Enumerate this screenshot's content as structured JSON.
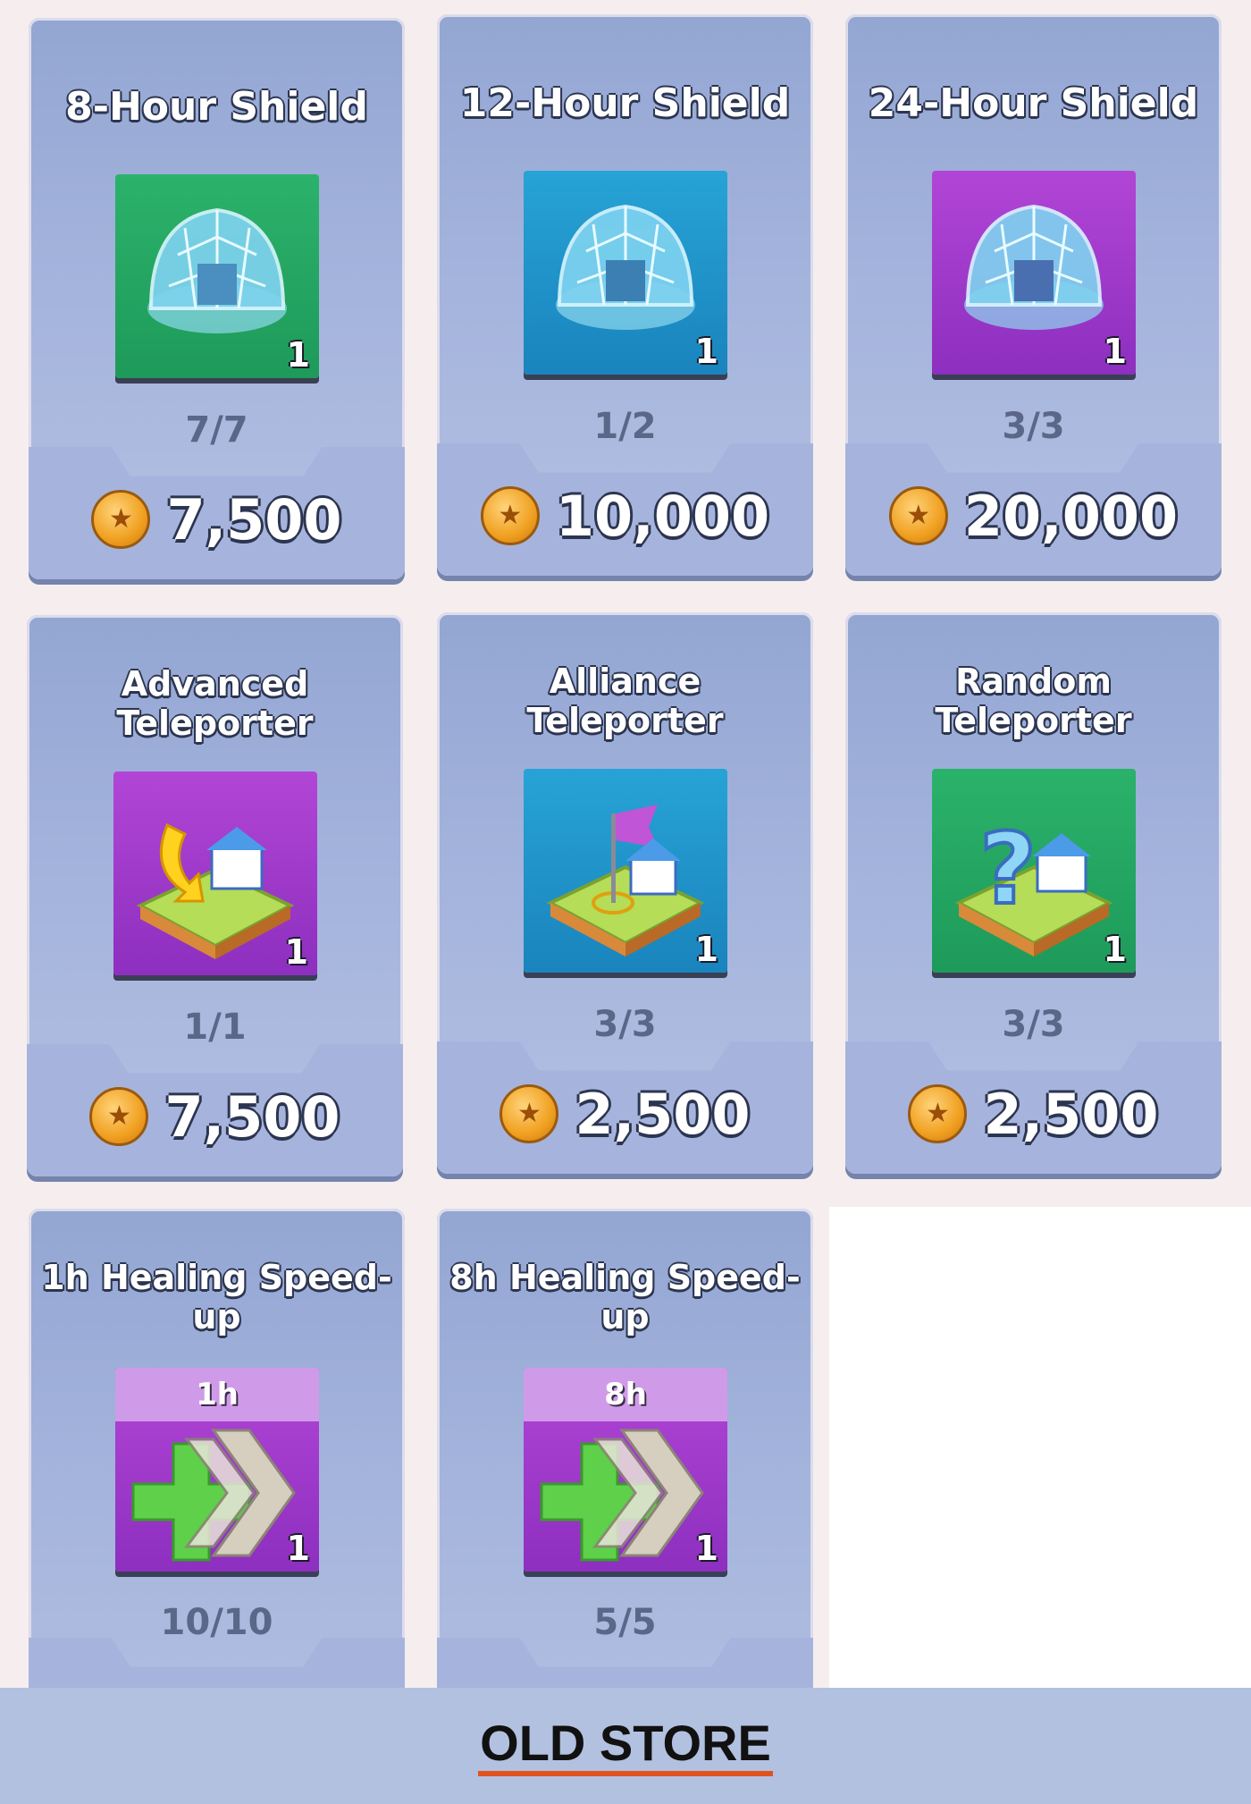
{
  "store": {
    "items": [
      {
        "title": "8-Hour Shield",
        "quantity": "1",
        "count": "7/7",
        "price": "7,500",
        "icon": "shield-dome-icon",
        "bg": "#23a863"
      },
      {
        "title": "12-Hour Shield",
        "quantity": "1",
        "count": "1/2",
        "price": "10,000",
        "icon": "shield-dome-icon",
        "bg": "#1f93cc"
      },
      {
        "title": "24-Hour Shield",
        "quantity": "1",
        "count": "3/3",
        "price": "20,000",
        "icon": "shield-dome-icon",
        "bg": "#a23dd0"
      },
      {
        "title": "Advanced Teleporter",
        "quantity": "1",
        "count": "1/1",
        "price": "7,500",
        "icon": "advanced-teleporter-icon",
        "bg": "#a23dd0"
      },
      {
        "title": "Alliance Teleporter",
        "quantity": "1",
        "count": "3/3",
        "price": "2,500",
        "icon": "alliance-teleporter-icon",
        "bg": "#1f93cc"
      },
      {
        "title": "Random Teleporter",
        "quantity": "1",
        "count": "3/3",
        "price": "2,500",
        "icon": "random-teleporter-icon",
        "bg": "#23a863"
      },
      {
        "title": "1h Healing Speed-up",
        "duration": "1h",
        "quantity": "1",
        "count": "10/10",
        "icon": "healing-speedup-icon",
        "bg": "#a23dd0"
      },
      {
        "title": "8h Healing Speed-up",
        "duration": "8h",
        "quantity": "1",
        "count": "5/5",
        "icon": "healing-speedup-icon",
        "bg": "#a23dd0"
      }
    ],
    "currency_icon": "coin-badge-icon"
  },
  "footer": {
    "label": "OLD STORE"
  },
  "colors": {
    "card": "#9eb0da",
    "accent_underline": "#e0531f"
  }
}
